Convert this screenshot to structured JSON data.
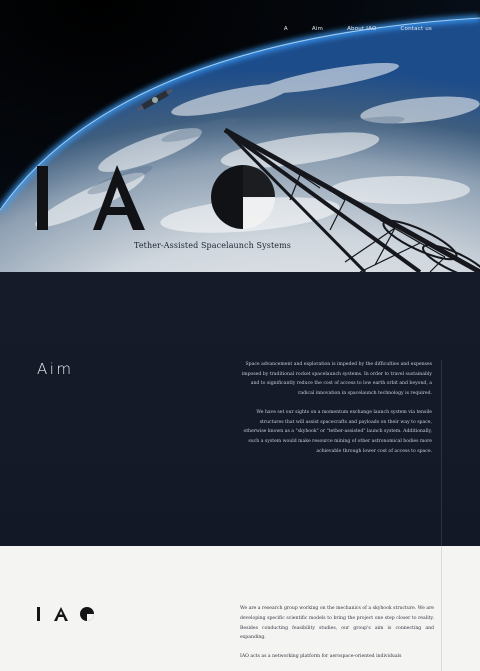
{
  "nav": {
    "items": [
      "A",
      "Aim",
      "About IAO",
      "Contact us"
    ]
  },
  "hero": {
    "logo_text": "IAO",
    "tagline": "Tether-Assisted Spacelaunch Systems"
  },
  "aim": {
    "title": "Aim",
    "paragraph_1": "Space advancement and exploration is impeded by the difficulties and expenses imposed by traditional rocket spacelaunch systems. In order to travel sustainably and to significantly reduce the cost of access to low earth orbit and beyond, a radical innovation in spacelaunch technology is required.",
    "paragraph_2": "We have set our sights on a momentum exchange launch system via tensile structures that will assist spacecrafts and payloads on their way to space, otherwise known as a \"skyhook\" or \"tether-assisted\" launch system. Additionally, such a system would make resource mining of other astronomical bodies more achievable through lower cost of access to space."
  },
  "iao": {
    "logo_text": "IAO",
    "paragraph_1": "We are a research group working on the mechanics of a skyhook structure. We are developing specific scientific models to bring the project one step closer to reality. Besides conducting feasibility studies, our group's aim is connecting and expanding.",
    "paragraph_2": "IAO acts as a networking platform for aerospace-oriented individuals"
  },
  "colors": {
    "hero_bg": "#04070c",
    "aim_bg": "#141a28",
    "iao_bg": "#f4f4f3",
    "logo_dark": "#141414"
  }
}
